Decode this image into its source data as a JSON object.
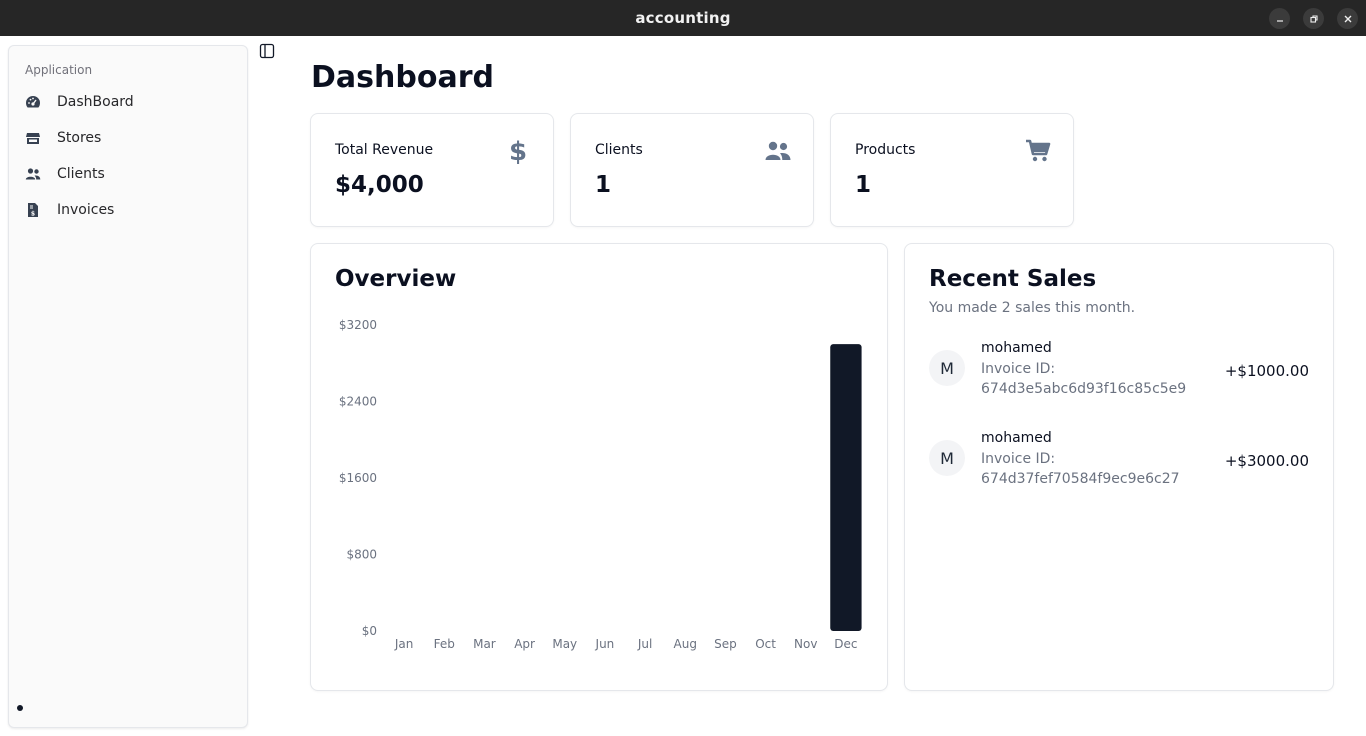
{
  "window": {
    "title": "accounting"
  },
  "sidebar": {
    "group_label": "Application",
    "items": [
      {
        "label": "DashBoard",
        "icon": "gauge-icon"
      },
      {
        "label": "Stores",
        "icon": "store-icon"
      },
      {
        "label": "Clients",
        "icon": "users-icon"
      },
      {
        "label": "Invoices",
        "icon": "invoice-icon"
      }
    ]
  },
  "page": {
    "title": "Dashboard"
  },
  "stats": [
    {
      "label": "Total Revenue",
      "value": "$4,000",
      "icon": "dollar-icon"
    },
    {
      "label": "Clients",
      "value": "1",
      "icon": "users-icon"
    },
    {
      "label": "Products",
      "value": "1",
      "icon": "cart-icon"
    }
  ],
  "overview": {
    "title": "Overview",
    "chart_data": {
      "type": "bar",
      "categories": [
        "Jan",
        "Feb",
        "Mar",
        "Apr",
        "May",
        "Jun",
        "Jul",
        "Aug",
        "Sep",
        "Oct",
        "Nov",
        "Dec"
      ],
      "values": [
        0,
        0,
        0,
        0,
        0,
        0,
        0,
        0,
        0,
        0,
        0,
        3000
      ],
      "yticks": [
        "$0",
        "$800",
        "$1600",
        "$2400",
        "$3200"
      ],
      "ylim": [
        0,
        3200
      ],
      "bar_color": "#111827",
      "grid": false,
      "title": "",
      "xlabel": "",
      "ylabel": ""
    }
  },
  "recent_sales": {
    "title": "Recent Sales",
    "subtitle": "You made 2 sales this month.",
    "items": [
      {
        "initial": "M",
        "name": "mohamed",
        "invoice_label": "Invoice ID:",
        "invoice_id": "674d3e5abc6d93f16c85c5e9",
        "amount": "+$1000.00"
      },
      {
        "initial": "M",
        "name": "mohamed",
        "invoice_label": "Invoice ID:",
        "invoice_id": "674d37fef70584f9ec9e6c27",
        "amount": "+$3000.00"
      }
    ]
  }
}
